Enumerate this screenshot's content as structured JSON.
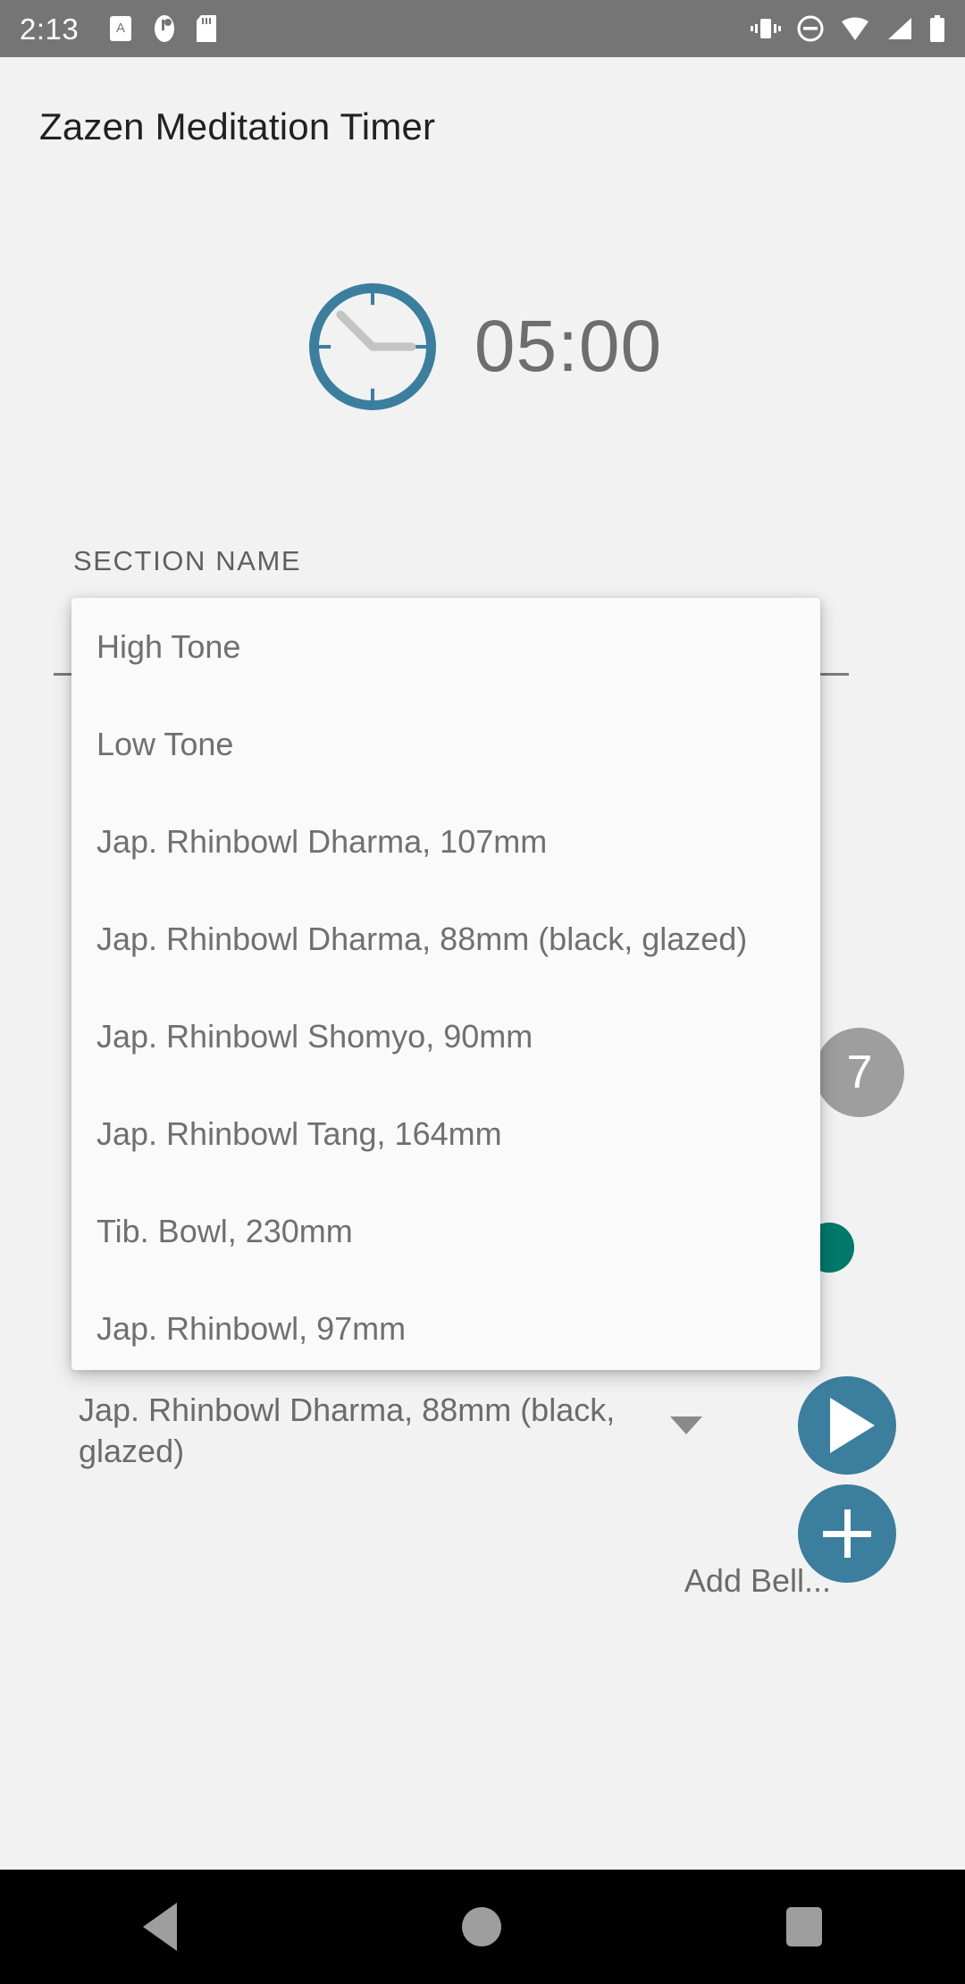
{
  "status_bar": {
    "time": "2:13",
    "left_icons": [
      "screenshot-icon",
      "app-notification-icon",
      "sd-card-icon"
    ],
    "right_icons": [
      "vibrate-icon",
      "do-not-disturb-icon",
      "wifi-icon",
      "signal-icon",
      "battery-icon"
    ]
  },
  "header": {
    "title": "Zazen Meditation Timer"
  },
  "timer": {
    "icon": "clock-icon",
    "value": "05:00",
    "accent_color": "#3c7e9e"
  },
  "section": {
    "label": "SECTION NAME"
  },
  "badge": {
    "value": "7"
  },
  "bell_picker": {
    "selected": "Jap. Rhinbowl Dharma, 88mm (black, glazed)",
    "caret": "dropdown-caret-icon",
    "play_icon": "play-icon"
  },
  "add_bell": {
    "label": "Add Bell...",
    "icon": "plus-icon"
  },
  "dropdown": {
    "open": true,
    "items": [
      {
        "label": "High Tone"
      },
      {
        "label": "Low Tone"
      },
      {
        "label": "Jap. Rhinbowl Dharma, 107mm"
      },
      {
        "label": "Jap. Rhinbowl Dharma, 88mm (black, glazed)"
      },
      {
        "label": "Jap. Rhinbowl Shomyo, 90mm"
      },
      {
        "label": "Jap. Rhinbowl Tang, 164mm"
      },
      {
        "label": "Tib. Bowl, 230mm"
      },
      {
        "label": "Jap. Rhinbowl, 97mm"
      }
    ]
  },
  "nav_bar": {
    "back": "back-icon",
    "home": "home-icon",
    "recents": "recents-icon"
  },
  "colors": {
    "accent": "#3c7e9e",
    "seek": "#00796b",
    "background": "#f2f2f2",
    "status_bar": "#757575"
  }
}
